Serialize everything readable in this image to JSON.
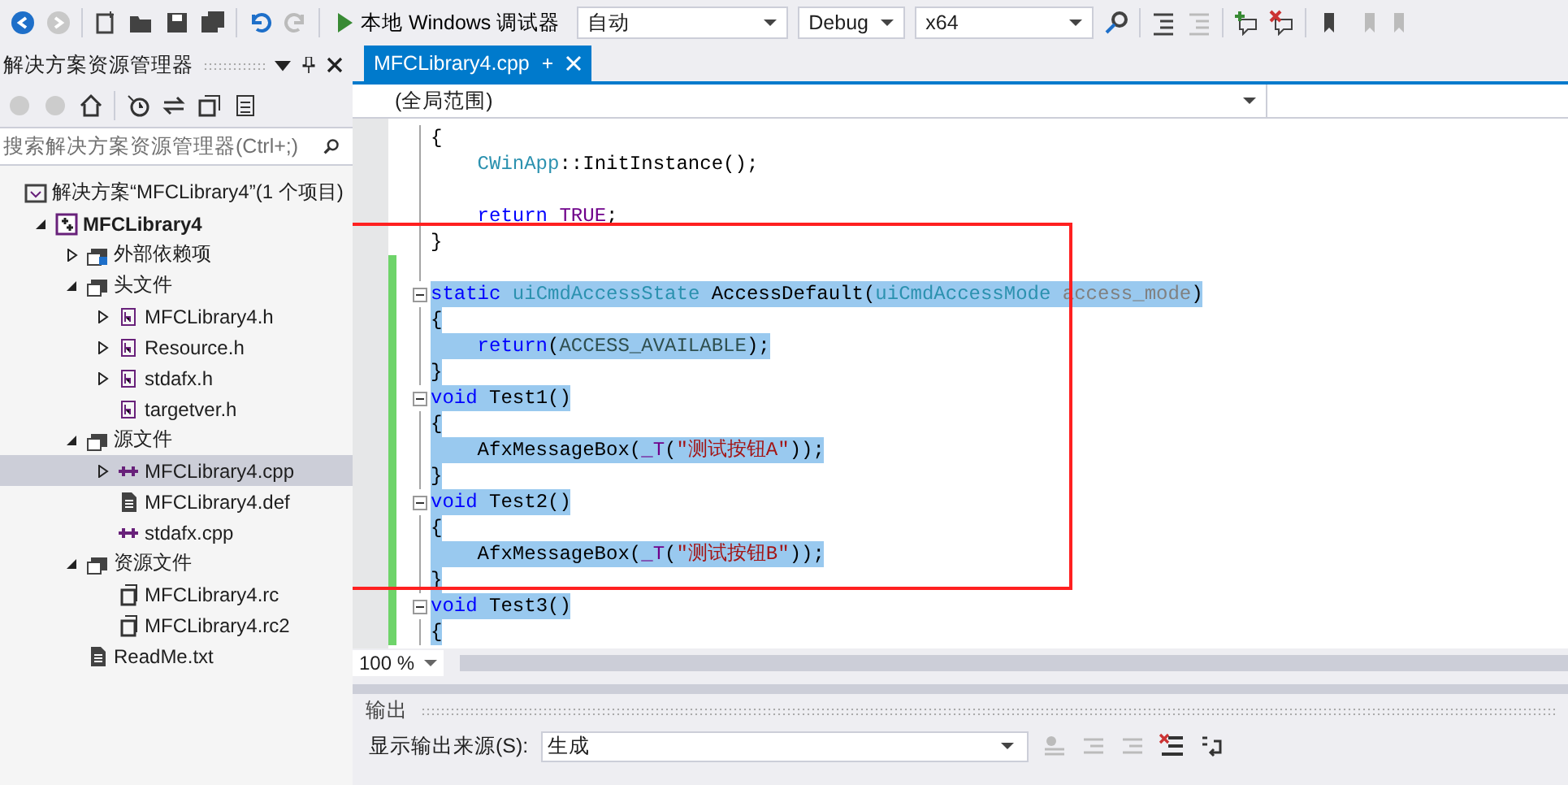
{
  "toolbar": {
    "debugger": "本地 Windows 调试器",
    "combos": [
      {
        "value": "自动",
        "kind": "wide"
      },
      {
        "value": "Debug",
        "kind": "short"
      },
      {
        "value": "x64",
        "kind": "mid"
      }
    ]
  },
  "solution_explorer": {
    "title": "解决方案资源管理器",
    "search": {
      "placeholder": "搜索解决方案资源管理器(Ctrl+;)"
    },
    "tree": [
      {
        "label": "解决方案“MFCLibrary4”(1 个项目)",
        "kind": "solution",
        "selected": false,
        "children": [
          {
            "label": "MFCLibrary4",
            "kind": "project",
            "expanded": true,
            "selected": false,
            "children": [
              {
                "label": "外部依赖项",
                "kind": "deps",
                "expanded": false,
                "selected": false
              },
              {
                "label": "头文件",
                "kind": "folder",
                "expanded": true,
                "selected": false,
                "children": [
                  {
                    "label": "MFCLibrary4.h",
                    "kind": "header",
                    "expanded": false,
                    "selected": false
                  },
                  {
                    "label": "Resource.h",
                    "kind": "header",
                    "expanded": false,
                    "selected": false
                  },
                  {
                    "label": "stdafx.h",
                    "kind": "header",
                    "expanded": false,
                    "selected": false
                  },
                  {
                    "label": "targetver.h",
                    "kind": "header",
                    "selected": false
                  }
                ]
              },
              {
                "label": "源文件",
                "kind": "folder",
                "expanded": true,
                "selected": false,
                "children": [
                  {
                    "label": "MFCLibrary4.cpp",
                    "kind": "cpp",
                    "expanded": false,
                    "selected": true
                  },
                  {
                    "label": "MFCLibrary4.def",
                    "kind": "def",
                    "selected": false
                  },
                  {
                    "label": "stdafx.cpp",
                    "kind": "cpp",
                    "selected": false
                  }
                ]
              },
              {
                "label": "资源文件",
                "kind": "folder",
                "expanded": true,
                "selected": false,
                "children": [
                  {
                    "label": "MFCLibrary4.rc",
                    "kind": "rc",
                    "selected": false
                  },
                  {
                    "label": "MFCLibrary4.rc2",
                    "kind": "rc",
                    "selected": false
                  }
                ]
              },
              {
                "label": "ReadMe.txt",
                "kind": "txt",
                "selected": false
              }
            ]
          }
        ]
      }
    ]
  },
  "editor": {
    "tabs": [
      {
        "label": "MFCLibrary4.cpp",
        "selected": true
      }
    ],
    "scope": "(全局范围)",
    "zoom": "100 %",
    "lines": [
      {
        "selected": false,
        "changed": false,
        "fold": false,
        "tokens": [
          {
            "kind": "plain",
            "text": "{"
          }
        ]
      },
      {
        "selected": false,
        "changed": false,
        "fold": false,
        "indented": true,
        "tokens": [
          {
            "kind": "type",
            "text": "CWinApp"
          },
          {
            "kind": "plain",
            "text": "::InitInstance();"
          }
        ]
      },
      {
        "changed": false,
        "fold": false
      },
      {
        "selected": false,
        "changed": false,
        "fold": false,
        "indented": true,
        "tokens": [
          {
            "kind": "kw",
            "text": "return"
          },
          {
            "kind": "macro",
            "text": " TRUE"
          },
          {
            "kind": "plain",
            "text": ";"
          }
        ]
      },
      {
        "selected": false,
        "changed": false,
        "fold": false,
        "tokens": [
          {
            "kind": "plain",
            "text": "}"
          }
        ]
      },
      {
        "changed": true,
        "fold": false
      },
      {
        "selected": true,
        "changed": true,
        "fold": true,
        "tokens": [
          {
            "kind": "kw",
            "text": "static"
          },
          {
            "kind": "type",
            "text": " uiCmdAccessState"
          },
          {
            "kind": "plain",
            "text": " AccessDefault("
          },
          {
            "kind": "type",
            "text": "uiCmdAccessMode"
          },
          {
            "kind": "param",
            "text": " access_mode"
          },
          {
            "kind": "plain",
            "text": ")"
          }
        ]
      },
      {
        "selected": true,
        "changed": true,
        "fold": false,
        "tokens": [
          {
            "kind": "plain",
            "text": "{"
          }
        ]
      },
      {
        "selected": true,
        "changed": true,
        "fold": false,
        "indented": true,
        "tokens": [
          {
            "kind": "kw",
            "text": "return"
          },
          {
            "kind": "plain",
            "text": "("
          },
          {
            "kind": "enum",
            "text": "ACCESS_AVAILABLE"
          },
          {
            "kind": "plain",
            "text": ");"
          }
        ]
      },
      {
        "selected": true,
        "changed": true,
        "fold": false,
        "tokens": [
          {
            "kind": "plain",
            "text": "}"
          }
        ]
      },
      {
        "selected": true,
        "changed": true,
        "fold": true,
        "tokens": [
          {
            "kind": "kw",
            "text": "void"
          },
          {
            "kind": "plain",
            "text": " Test1()"
          }
        ]
      },
      {
        "selected": true,
        "changed": true,
        "fold": false,
        "tokens": [
          {
            "kind": "plain",
            "text": "{"
          }
        ]
      },
      {
        "selected": true,
        "changed": true,
        "fold": false,
        "indented": true,
        "tokens": [
          {
            "kind": "plain",
            "text": "AfxMessageBox("
          },
          {
            "kind": "macro",
            "text": "_T"
          },
          {
            "kind": "plain",
            "text": "("
          },
          {
            "kind": "str",
            "text": "\"测试按钮A\""
          },
          {
            "kind": "plain",
            "text": "));"
          }
        ]
      },
      {
        "selected": true,
        "changed": true,
        "fold": false,
        "tokens": [
          {
            "kind": "plain",
            "text": "}"
          }
        ]
      },
      {
        "selected": true,
        "changed": true,
        "fold": true,
        "tokens": [
          {
            "kind": "kw",
            "text": "void"
          },
          {
            "kind": "plain",
            "text": " Test2()"
          }
        ]
      },
      {
        "selected": true,
        "changed": true,
        "fold": false,
        "tokens": [
          {
            "kind": "plain",
            "text": "{"
          }
        ]
      },
      {
        "selected": true,
        "changed": true,
        "fold": false,
        "indented": true,
        "tokens": [
          {
            "kind": "plain",
            "text": "AfxMessageBox("
          },
          {
            "kind": "macro",
            "text": "_T"
          },
          {
            "kind": "plain",
            "text": "("
          },
          {
            "kind": "str",
            "text": "\"测试按钮B\""
          },
          {
            "kind": "plain",
            "text": "));"
          }
        ]
      },
      {
        "selected": true,
        "changed": true,
        "fold": false,
        "tokens": [
          {
            "kind": "plain",
            "text": "}"
          }
        ]
      },
      {
        "selected": true,
        "changed": true,
        "fold": true,
        "tokens": [
          {
            "kind": "kw",
            "text": "void"
          },
          {
            "kind": "plain",
            "text": " Test3()"
          }
        ]
      },
      {
        "selected": true,
        "changed": true,
        "fold": false,
        "tokens": [
          {
            "kind": "plain",
            "text": "{"
          }
        ]
      }
    ]
  },
  "output": {
    "title": "输出",
    "source_label": "显示输出来源(S):",
    "source": "生成"
  }
}
